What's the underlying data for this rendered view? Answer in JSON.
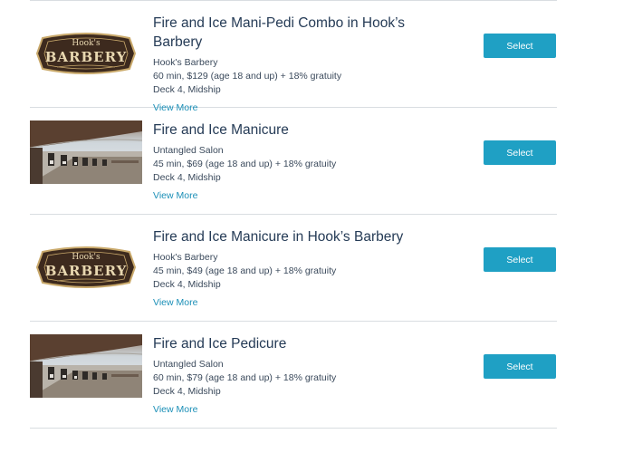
{
  "colors": {
    "accent": "#1fa0c4",
    "link": "#1b8fb7",
    "title": "#253b56"
  },
  "services": [
    {
      "title_line1": "Fire and Ice Mani-Pedi Combo in Hook’s",
      "title_line2": "Barbery",
      "venue": "Hook's Barbery",
      "details": "60 min, $129 (age 18 and up) + 18% gratuity",
      "location": "Deck 4, Midship",
      "more": "View More",
      "button": "Select",
      "image": "hooks-barbery-logo",
      "logo_text_top": "Hook's",
      "logo_text_main": "BARBERY"
    },
    {
      "title_line1": "Fire and Ice Manicure",
      "venue": "Untangled Salon",
      "details": "45 min, $69 (age 18 and up) + 18% gratuity",
      "location": "Deck 4, Midship",
      "more": "View More",
      "button": "Select",
      "image": "salon-photo"
    },
    {
      "title_line1": "Fire and Ice Manicure in Hook’s Barbery",
      "venue": "Hook's Barbery",
      "details": "45 min, $49 (age 18 and up) + 18% gratuity",
      "location": "Deck 4, Midship",
      "more": "View More",
      "button": "Select",
      "image": "hooks-barbery-logo",
      "logo_text_top": "Hook's",
      "logo_text_main": "BARBERY"
    },
    {
      "title_line1": "Fire and Ice Pedicure",
      "venue": "Untangled Salon",
      "details": "60 min, $79 (age 18 and up) + 18% gratuity",
      "location": "Deck 4, Midship",
      "more": "View More",
      "button": "Select",
      "image": "salon-photo"
    }
  ]
}
